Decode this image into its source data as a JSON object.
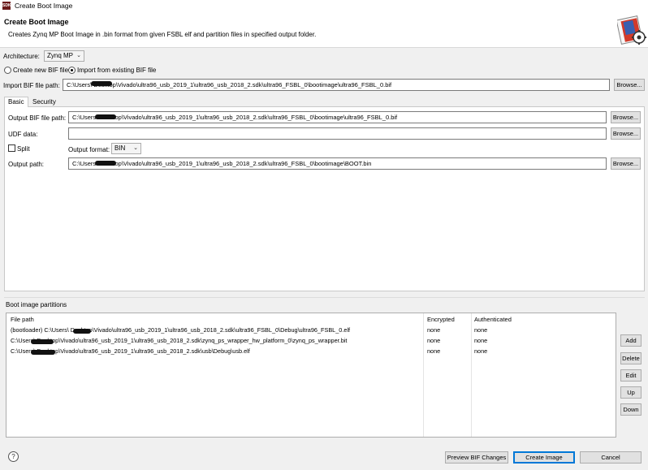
{
  "window": {
    "title": "Create Boot Image",
    "icon_label": "SDK"
  },
  "header": {
    "title": "Create Boot Image",
    "description": "Creates Zynq MP Boot Image in .bin format from given FSBL elf and partition files in specified output folder.",
    "logo_icon": "boot-image-gear-icon"
  },
  "architecture": {
    "label": "Architecture:",
    "value": "Zynq MP"
  },
  "bif_mode": {
    "create_label": "Create new BIF file",
    "import_label": "Import from existing BIF file",
    "selected": "import"
  },
  "import_bif": {
    "label": "Import BIF file path:",
    "value": "C:\\Users\\        Desktop\\Vivado\\ultra96_usb_2019_1\\ultra96_usb_2018_2.sdk\\ultra96_FSBL_0\\bootimage\\ultra96_FSBL_0.bif",
    "browse": "Browse..."
  },
  "tabs": [
    {
      "label": "Basic",
      "active": true
    },
    {
      "label": "Security",
      "active": false
    }
  ],
  "basic": {
    "output_bif": {
      "label": "Output BIF file path:",
      "value": "C:\\Users\\        Desktop\\Vivado\\ultra96_usb_2019_1\\ultra96_usb_2018_2.sdk\\ultra96_FSBL_0\\bootimage\\ultra96_FSBL_0.bif",
      "browse": "Browse..."
    },
    "udf": {
      "label": "UDF data:",
      "value": "",
      "browse": "Browse..."
    },
    "split": {
      "label": "Split",
      "checked": false
    },
    "output_format": {
      "label": "Output format:",
      "value": "BIN"
    },
    "output_path": {
      "label": "Output path:",
      "value": "C:\\Users\\        Desktop\\Vivado\\ultra96_usb_2019_1\\ultra96_usb_2018_2.sdk\\ultra96_FSBL_0\\bootimage\\BOOT.bin",
      "browse": "Browse..."
    }
  },
  "partitions": {
    "section_label": "Boot image partitions",
    "columns": [
      "File path",
      "Encrypted",
      "Authenticated"
    ],
    "rows": [
      [
        "(bootloader) C:\\Users\\        Desktop\\Vivado\\ultra96_usb_2019_1\\ultra96_usb_2018_2.sdk\\ultra96_FSBL_0\\Debug\\ultra96_FSBL_0.elf",
        "none",
        "none"
      ],
      [
        "C:\\Users\\        Desktop\\Vivado\\ultra96_usb_2019_1\\ultra96_usb_2018_2.sdk\\zynq_ps_wrapper_hw_platform_0\\zynq_ps_wrapper.bit",
        "none",
        "none"
      ],
      [
        "C:\\Users\\        Desktop\\Vivado\\ultra96_usb_2019_1\\ultra96_usb_2018_2.sdk\\usb\\Debug\\usb.elf",
        "none",
        "none"
      ]
    ],
    "buttons": {
      "add": "Add",
      "delete": "Delete",
      "edit": "Edit",
      "up": "Up",
      "down": "Down"
    }
  },
  "footer": {
    "help": "?",
    "preview": "Preview BIF Changes",
    "create": "Create Image",
    "cancel": "Cancel"
  },
  "colors": {
    "accent": "#0078d7",
    "background": "#f0f0f0"
  }
}
